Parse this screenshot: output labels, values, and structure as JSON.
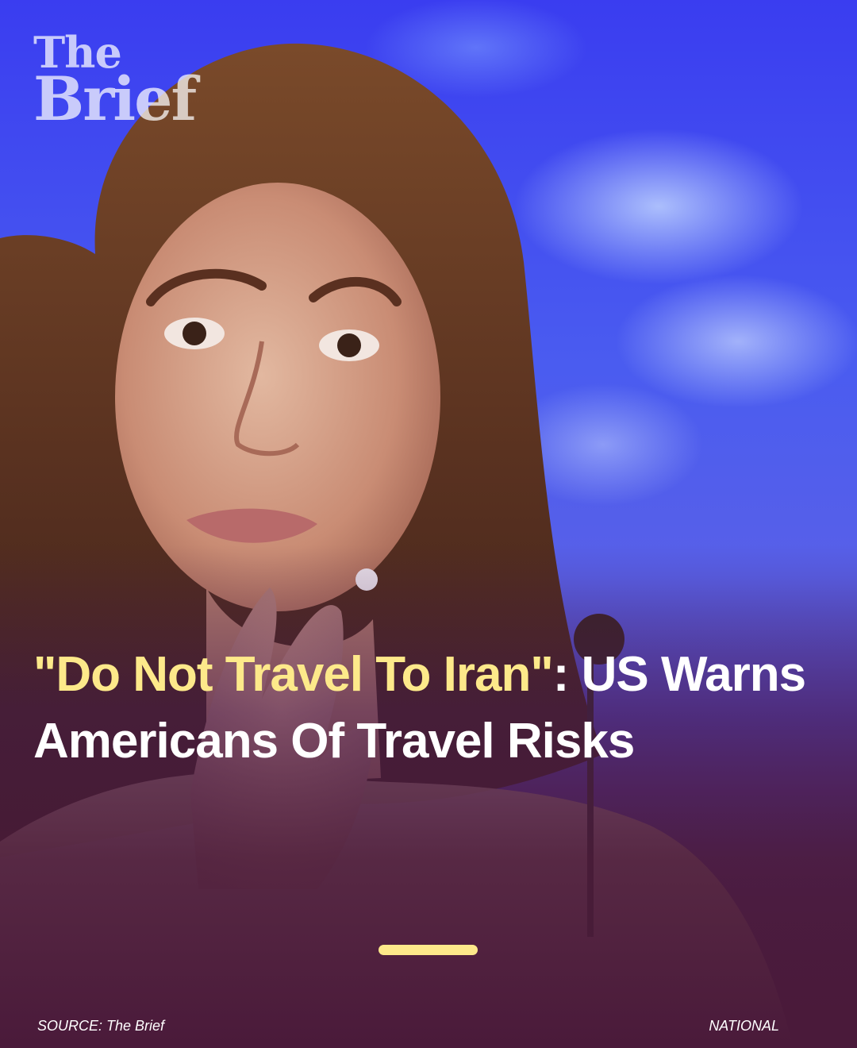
{
  "brand": {
    "logo_line1": "The",
    "logo_line2": "Brief"
  },
  "headline": {
    "highlight": "\"Do Not Travel To Iran\"",
    "rest": ": US Warns Americans Of Travel Risks"
  },
  "footer": {
    "source": "SOURCE: The Brief",
    "category": "NATIONAL"
  },
  "colors": {
    "accent": "#fde98a",
    "background_bottom": "#4a1a3a",
    "background_top": "#3a3df0"
  }
}
